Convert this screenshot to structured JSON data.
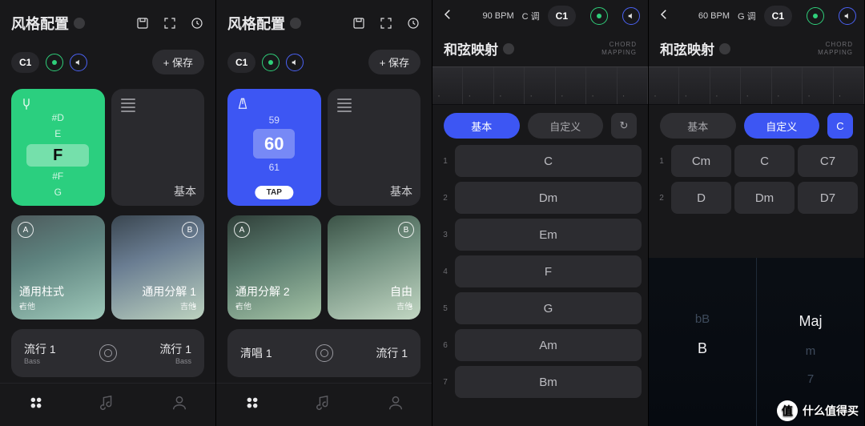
{
  "panel1": {
    "title": "风格配置",
    "c1": "C1",
    "save": "+ 保存",
    "green": {
      "up2": "#D",
      "up1": "E",
      "sel": "F",
      "dn1": "#F",
      "dn2": "G"
    },
    "darkTileLabel": "基本",
    "imgTiles": [
      {
        "badge": "A",
        "title": "通用柱式",
        "sub": "吉他"
      },
      {
        "badge": "B",
        "title": "通用分解 1",
        "sub": "吉他"
      }
    ],
    "grayTile": {
      "left_title": "流行 1",
      "left_sub": "Bass",
      "right_title": "流行 1",
      "right_sub": "Bass"
    }
  },
  "panel2": {
    "title": "风格配置",
    "c1": "C1",
    "save": "+ 保存",
    "bpm": {
      "up": "59",
      "sel": "60",
      "dn": "61",
      "tap": "TAP"
    },
    "darkTileLabel": "基本",
    "imgTiles": [
      {
        "badge": "A",
        "title": "通用分解 2",
        "sub": "吉他"
      },
      {
        "badge": "B",
        "title": "自由",
        "sub": "吉他"
      }
    ],
    "grayTile": {
      "left_title": "清唱 1",
      "left_sub": "",
      "right_title": "流行 1",
      "right_sub": ""
    }
  },
  "panel3": {
    "bpm": "90 BPM",
    "key": "C 调",
    "c1": "C1",
    "subTitle": "和弦映射",
    "meta1": "CHORD",
    "meta2": "MAPPING",
    "pills": {
      "basic": "基本",
      "custom": "自定义",
      "reset": "↻"
    },
    "chords": [
      {
        "n": "1",
        "name": "C"
      },
      {
        "n": "2",
        "name": "Dm"
      },
      {
        "n": "3",
        "name": "Em"
      },
      {
        "n": "4",
        "name": "F"
      },
      {
        "n": "5",
        "name": "G"
      },
      {
        "n": "6",
        "name": "Am"
      },
      {
        "n": "7",
        "name": "Bm"
      }
    ]
  },
  "panel4": {
    "bpm": "60 BPM",
    "key": "G 调",
    "c1": "C1",
    "subTitle": "和弦映射",
    "meta1": "CHORD",
    "meta2": "MAPPING",
    "pills": {
      "basic": "基本",
      "custom": "自定义",
      "reset": "C"
    },
    "rows": [
      {
        "n": "1",
        "a": "Cm",
        "b": "C",
        "c": "C7"
      },
      {
        "n": "2",
        "a": "D",
        "b": "Dm",
        "c": "D7"
      }
    ],
    "picker": {
      "left": {
        "above": "bB",
        "sel": "B",
        "below": ""
      },
      "right": {
        "above": "",
        "sel": "Maj",
        "below1": "m",
        "below2": "7"
      }
    }
  },
  "watermark": {
    "badge": "值",
    "text": "什么值得买"
  }
}
